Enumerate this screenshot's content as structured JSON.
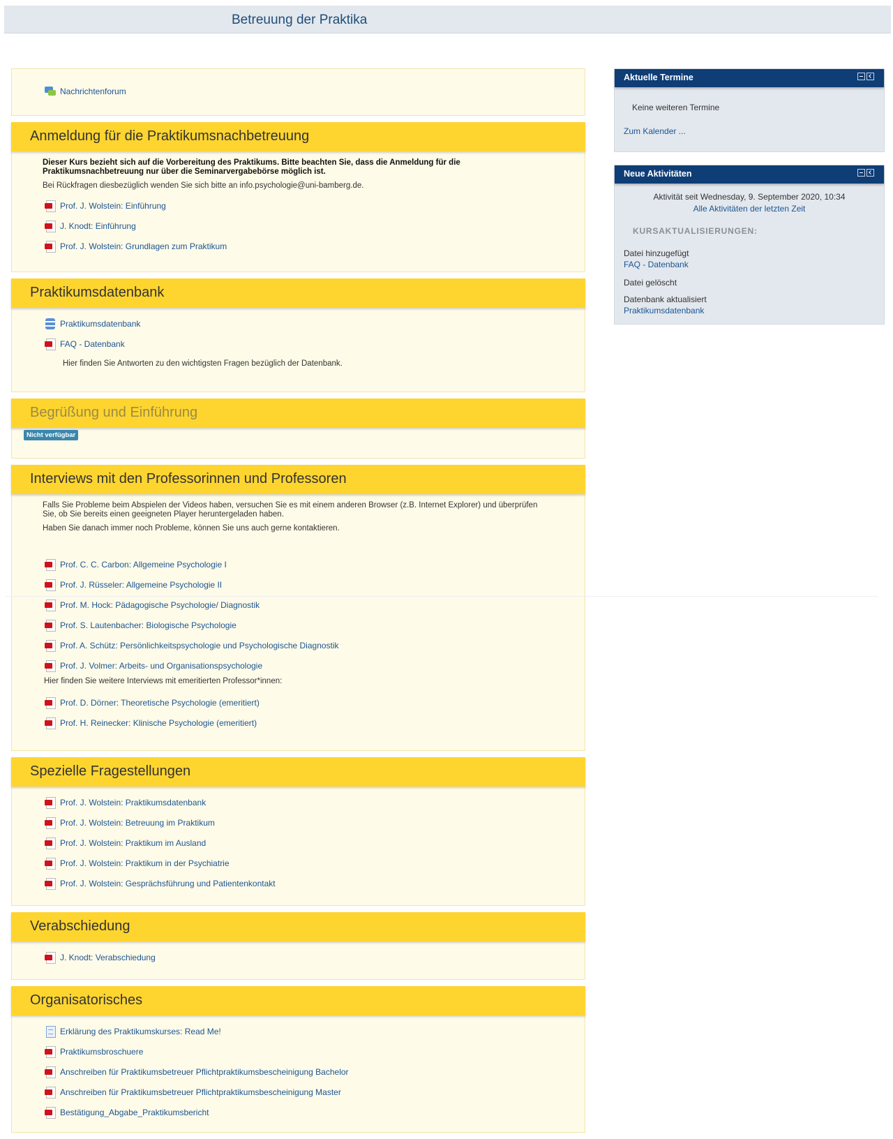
{
  "header": {
    "title": "Betreuung der Praktika"
  },
  "intro": {
    "forum_label": "Nachrichtenforum"
  },
  "sections": [
    {
      "title": "Anmeldung für die Praktikumsnachbetreuung",
      "summary_bold": "Dieser Kurs bezieht sich auf die Vorbereitung des Praktikums. Bitte beachten Sie, dass die Anmeldung für die Praktikumsnachbetreuung nur über die Seminarvergabebörse möglich ist.",
      "summary": "Bei Rückfragen diesbezüglich wenden Sie sich bitte an info.psychologie@uni-bamberg.de.",
      "items": [
        "Prof. J. Wolstein: Einführung",
        "J. Knodt: Einführung",
        "Prof. J. Wolstein: Grundlagen zum Praktikum"
      ]
    },
    {
      "title": "Praktikumsdatenbank",
      "items": [
        "Praktikumsdatenbank",
        "FAQ - Datenbank"
      ],
      "faq_desc": "Hier finden Sie Antworten zu den wichtigsten Fragen bezüglich der Datenbank."
    },
    {
      "title": "Begrüßung und Einführung",
      "badge": "Nicht verfügbar"
    },
    {
      "title": "Interviews mit den Professorinnen und Professoren",
      "summary_1": "Falls Sie Probleme beim Abspielen der Videos haben, versuchen Sie es mit einem anderen Browser (z.B. Internet Explorer) und überprüfen Sie, ob Sie bereits einen geeigneten Player heruntergeladen haben.",
      "summary_2": "Haben Sie danach immer noch Probleme, können Sie uns auch gerne kontaktieren.",
      "items": [
        "Prof. C. C. Carbon: Allgemeine Psychologie I",
        "Prof. J. Rüsseler: Allgemeine Psychologie II",
        "Prof. M. Hock: Pädagogische Psychologie/ Diagnostik",
        "Prof. S. Lautenbacher: Biologische Psychologie",
        "Prof. A. Schütz: Persönlichkeitspsychologie und Psychologische Diagnostik",
        "Prof. J. Volmer: Arbeits- und Organisationspsychologie"
      ],
      "emeriti_note": "Hier finden Sie weitere Interviews mit emeritierten Professor*innen:",
      "emeriti_items": [
        "Prof. D. Dörner: Theoretische Psychologie (emeritiert)",
        "Prof. H. Reinecker: Klinische Psychologie (emeritiert)"
      ]
    },
    {
      "title": "Spezielle Fragestellungen",
      "items": [
        "Prof. J. Wolstein: Praktikumsdatenbank",
        "Prof. J. Wolstein: Betreuung im Praktikum",
        "Prof. J. Wolstein: Praktikum im Ausland",
        "Prof. J. Wolstein: Praktikum in der Psychiatrie",
        "Prof. J. Wolstein: Gesprächsführung und Patientenkontakt"
      ]
    },
    {
      "title": "Verabschiedung",
      "items": [
        "J. Knodt: Verabschiedung"
      ]
    },
    {
      "title": "Organisatorisches",
      "items": [
        "Erklärung des Praktikumskurses: Read Me!",
        "Praktikumsbroschuere",
        "Anschreiben für Praktikumsbetreuer Pflichtpraktikumsbescheinigung Bachelor",
        "Anschreiben für Praktikumsbetreuer Pflichtpraktikumsbescheinigung Master",
        "Bestätigung_Abgabe_Praktikumsbericht"
      ]
    }
  ],
  "blocks": {
    "events": {
      "title": "Aktuelle Termine",
      "none": "Keine weiteren Termine",
      "calendar_link": "Zum Kalender ..."
    },
    "activity": {
      "title": "Neue Aktivitäten",
      "since": "Aktivität seit Wednesday, 9. September 2020, 10:34",
      "all_link": "Alle Aktivitäten der letzten Zeit",
      "subhead": "KURSAKTUALISIERUNGEN:",
      "updates": [
        {
          "type": "Datei hinzugefügt",
          "link": "FAQ - Datenbank"
        },
        {
          "type": "Datei gelöscht",
          "link": ""
        },
        {
          "type": "Datenbank aktualisiert",
          "link": "Praktikumsdatenbank"
        }
      ]
    }
  }
}
